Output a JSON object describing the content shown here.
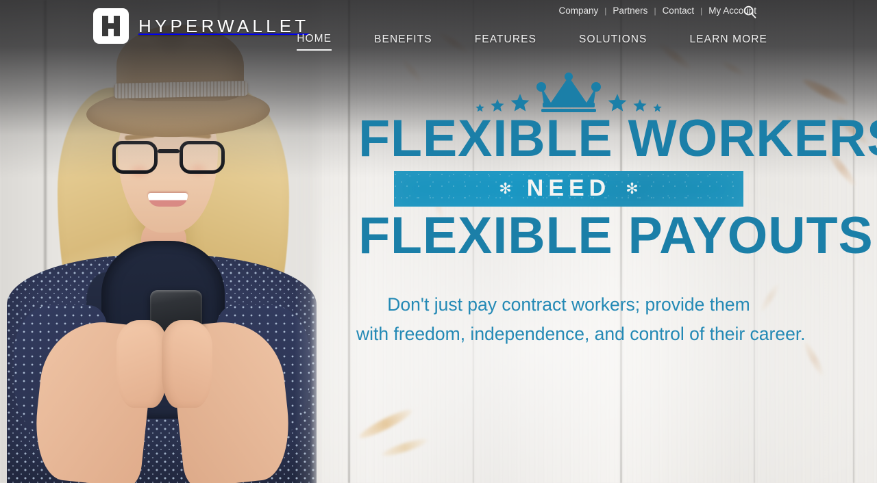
{
  "brand": {
    "logo_text": "HYPERWALLET",
    "logo_mark": "hyperwallet-h-monogram"
  },
  "header": {
    "utility_nav": [
      {
        "label": "Company"
      },
      {
        "label": "Partners"
      },
      {
        "label": "Contact"
      },
      {
        "label": "My Account"
      }
    ],
    "separator": "|",
    "search_icon": "search-icon",
    "main_nav": [
      {
        "label": "HOME",
        "active": true
      },
      {
        "label": "BENEFITS",
        "active": false
      },
      {
        "label": "FEATURES",
        "active": false
      },
      {
        "label": "SOLUTIONS",
        "active": false
      },
      {
        "label": "LEARN MORE",
        "active": false
      }
    ]
  },
  "hero": {
    "crest_icon": "crown-with-stars-icon",
    "headline_line1": "FLEXIBLE WORKERS",
    "headline_banner": "NEED",
    "banner_ornament_left": "✻",
    "banner_ornament_right": "✻",
    "headline_line2": "FLEXIBLE PAYOUTS",
    "subtext_line1": "Don't just pay contract workers; provide them",
    "subtext_line2": "with freedom, independence, and control of their career.",
    "image_alt": "woman-with-fedora-and-glasses-using-smartphone"
  },
  "colors": {
    "headline_blue": "#1b7fa8",
    "banner_teal": "#1b93bd",
    "subtext_blue": "#2389b5",
    "nav_text": "#f2f2f2",
    "background_wood": "#eae8e5"
  }
}
